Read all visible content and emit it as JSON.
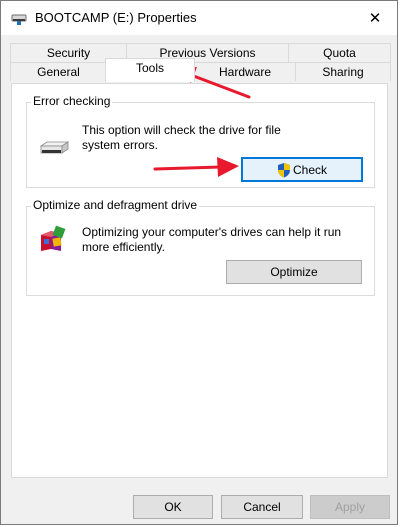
{
  "window": {
    "title": "BOOTCAMP (E:) Properties",
    "close_glyph": "✕"
  },
  "tabs": {
    "row1": [
      {
        "label": "Security"
      },
      {
        "label": "Previous Versions"
      },
      {
        "label": "Quota"
      }
    ],
    "row2": [
      {
        "label": "General"
      },
      {
        "label": "Tools"
      },
      {
        "label": "Hardware"
      },
      {
        "label": "Sharing"
      }
    ],
    "active": "Tools"
  },
  "error_checking": {
    "title": "Error checking",
    "description_line1": "This option will check the drive for file",
    "description_line2": "system errors.",
    "button_label": "Check",
    "icon": "drive-icon"
  },
  "optimize": {
    "title": "Optimize and defragment drive",
    "description_line1": "Optimizing your computer's drives can help it run",
    "description_line2": "more efficiently.",
    "button_label": "Optimize",
    "icon": "defrag-icon"
  },
  "footer": {
    "ok_label": "OK",
    "cancel_label": "Cancel",
    "apply_label": "Apply"
  },
  "colors": {
    "annotation_arrow": "#e8192c",
    "focus_border": "#0078d7"
  }
}
